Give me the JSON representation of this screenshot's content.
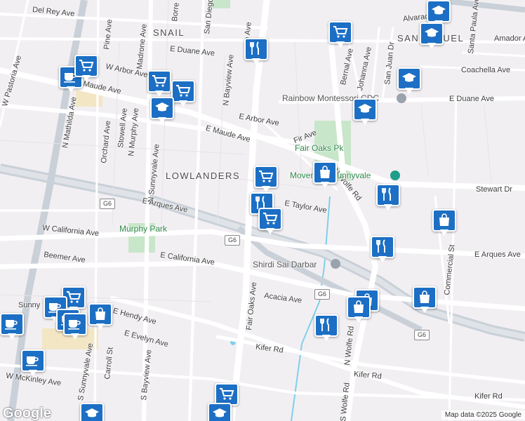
{
  "map": {
    "colors": {
      "background": "#f2eff3",
      "road": "#ffffff",
      "highway": "#c9d0d8",
      "park": "#c8e6c9",
      "water": "#7fd0ea",
      "pin": "#1c6fc4"
    },
    "areas": {
      "snail": "SNAIL",
      "lowlanders": "LOWLANDERS",
      "san_miguel": "SAN MIGUEL"
    },
    "streets": {
      "del_rey": "Del Rey Ave",
      "pine": "Pine Ave",
      "madrone": "Madrone Ave",
      "borregas": "Borre",
      "san_diego": "San Diego",
      "w_arbor": "W Arbor Ave",
      "e_duane_w": "E Duane Ave",
      "maude": "Maude Ave",
      "n_bayview": "N Bayview Ave",
      "pastoria": "W Pastoria Ave",
      "mathilda": "N Mathilda Ave",
      "stowell": "Stowell Ave",
      "n_murphy": "N Murphy Ave",
      "orchard": "Orchard Ave",
      "n_sunnyvale": "N Sunnyvale Ave",
      "e_arbor": "E Arbor Ave",
      "e_maude": "E Maude Ave",
      "fir": "Fir Ave",
      "e_arques": "E Arques Ave",
      "e_taylor": "E Taylor Ave",
      "w_california": "W California Ave",
      "e_california": "E California Ave",
      "beemer": "Beemer Ave",
      "fair_oaks": "Fair Oaks Ave",
      "acacia": "Acacia Ave",
      "hendy": "E Hendy Ave",
      "e_evelyn": "E Evelyn Ave",
      "s_sunnyvale": "S Sunnyvale Ave",
      "carroll": "Carroll St",
      "s_bayview": "S Bayview Ave",
      "kifer": "Kifer Rd",
      "kifer2": "Kifer Rd",
      "kifer3": "Kifer Rd",
      "w_mckinley": "W McKinley Ave",
      "n_wolfe": "N Wolfe Rd",
      "n_wolfe2": "N Wolfe Rd",
      "s_wolfe": "S Wolfe Rd",
      "stewart": "Stewart Dr",
      "e_arques_e": "E Arques Ave",
      "commercial": "Commercial St",
      "bernal": "Bernal Ave",
      "johanna": "Johanna Ave",
      "san_juan": "San Juan Dr",
      "alvarado": "Alvarado Ave",
      "santa_paula": "Santa Paula Ave",
      "amador": "Amador Av",
      "coachella": "Coachella Ave",
      "e_duane_e": "E Duane Ave",
      "fair_oaks_top": "e Ave",
      "sunny": "Sunny"
    },
    "pois": {
      "rainbow": "Rainbow Montessori CDC",
      "fair_oaks_pk": "Fair Oaks Pk",
      "movement": "Movement Sunnyvale",
      "shirdi": "Shirdi Sai Darbar",
      "murphy_park": "Murphy Park"
    },
    "highway_shield": "G6",
    "logo": "Google",
    "attribution": "Map data ©2025 Google"
  }
}
